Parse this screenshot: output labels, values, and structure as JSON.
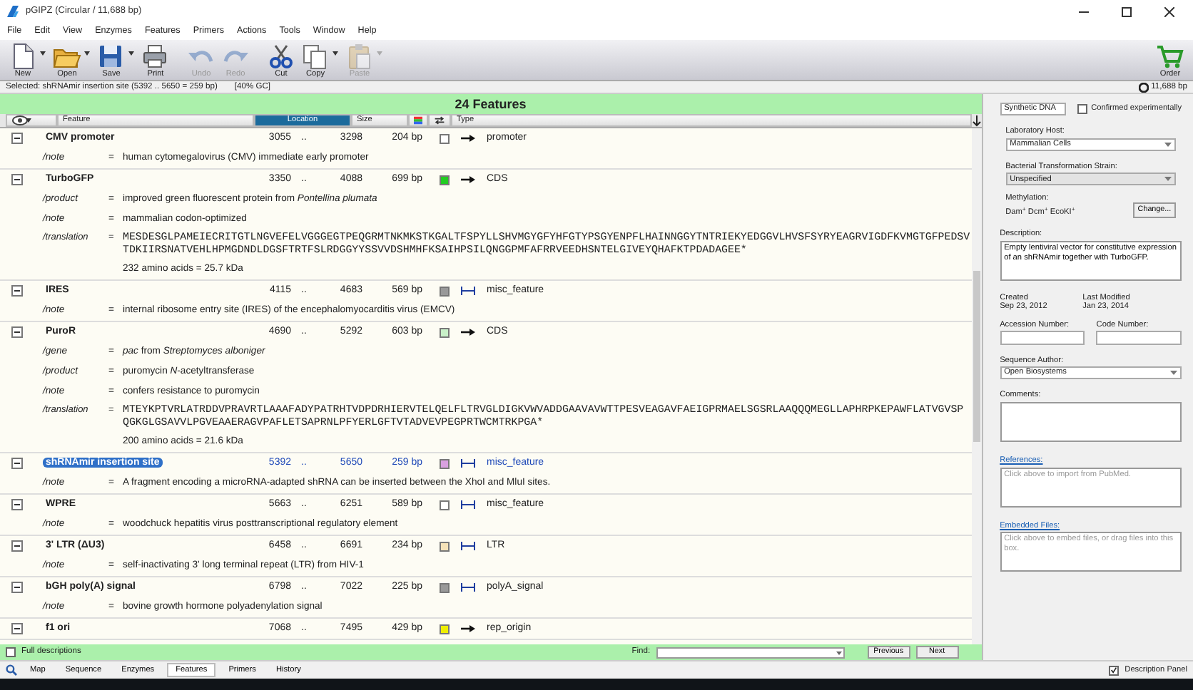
{
  "window": {
    "title": "pGIPZ  (Circular / 11,688 bp)"
  },
  "menu": [
    "File",
    "Edit",
    "View",
    "Enzymes",
    "Features",
    "Primers",
    "Actions",
    "Tools",
    "Window",
    "Help"
  ],
  "toolbar": [
    {
      "label": "New",
      "has_menu": true,
      "disabled": false
    },
    {
      "label": "Open",
      "has_menu": true,
      "disabled": false
    },
    {
      "label": "Save",
      "has_menu": true,
      "disabled": false
    },
    {
      "label": "Print",
      "has_menu": false,
      "disabled": false
    },
    {
      "label": "Undo",
      "has_menu": false,
      "disabled": true
    },
    {
      "label": "Redo",
      "has_menu": false,
      "disabled": true
    },
    {
      "label": "Cut",
      "has_menu": false,
      "disabled": false
    },
    {
      "label": "Copy",
      "has_menu": true,
      "disabled": false
    },
    {
      "label": "Paste",
      "has_menu": true,
      "disabled": true
    }
  ],
  "order_button": {
    "label": "Order"
  },
  "selection_bar": {
    "text": "Selected:  shRNAmir insertion site  (5392 .. 5650  =  259 bp)",
    "gc": "[40% GC]",
    "length": "11,688 bp"
  },
  "features_panel": {
    "title": "24 Features",
    "columns": [
      {
        "label": "Feature",
        "selected": false
      },
      {
        "label": "Location",
        "selected": true
      },
      {
        "label": "Size",
        "selected": false
      },
      {
        "label": "Type",
        "selected": false
      }
    ],
    "features": [
      {
        "name": "CMV promoter",
        "start": "3055",
        "sep": "..",
        "end": "3298",
        "size": "204 bp",
        "color": "#ffffff",
        "kind": "forward",
        "type": "promoter",
        "expanded": true,
        "selected": false,
        "qualifiers": [
          {
            "kind": "text",
            "key": "/note",
            "eq": "=",
            "value": "human cytomegalovirus (CMV) immediate early promoter"
          }
        ]
      },
      {
        "name": "TurboGFP",
        "start": "3350",
        "sep": "..",
        "end": "4088",
        "size": "699 bp",
        "color": "#22cc22",
        "kind": "forward",
        "type": "CDS",
        "expanded": true,
        "selected": false,
        "qualifiers": [
          {
            "kind": "text",
            "key": "/product",
            "eq": "=",
            "value": "improved green fluorescent protein from *Pontellina plumata*"
          },
          {
            "kind": "text",
            "key": "/note",
            "eq": "=",
            "value": "mammalian codon-optimized"
          },
          {
            "kind": "translation",
            "key": "/translation",
            "eq": "=",
            "lines": [
              "MESDESGLPAMEIECRITGTLNGVEFELVGGGEGTPEQGRMTNKMKSTKGALTFSPYLLSHVMGYGFYHFGTYPSGYENPFLHAINNGGYTNTRIEKYEDGGVLHVSFSYRYEAGRVIGDFKVMGTGFPEDSV",
              "TDKIIRSNATVEHLHPMGDNDLDGSFTRTFSLRDGGYYSSVVDSHMHFKSAIHPSILQNGGPMFAFRRVEEDHSNTELGIVEYQHAFKTPDADAGEE*"
            ],
            "summary": "232 amino acids  =  25.7 kDa"
          }
        ]
      },
      {
        "name": "IRES",
        "start": "4115",
        "sep": "..",
        "end": "4683",
        "size": "569 bp",
        "color": "#999999",
        "kind": "none",
        "type": "misc_feature",
        "expanded": true,
        "selected": false,
        "qualifiers": [
          {
            "kind": "text",
            "key": "/note",
            "eq": "=",
            "value": "internal ribosome entry site (IRES) of the encephalomyocarditis virus (EMCV)"
          }
        ]
      },
      {
        "name": "PuroR",
        "start": "4690",
        "sep": "..",
        "end": "5292",
        "size": "603 bp",
        "color": "#c8f0c8",
        "kind": "forward",
        "type": "CDS",
        "expanded": true,
        "selected": false,
        "qualifiers": [
          {
            "kind": "text",
            "key": "/gene",
            "eq": "=",
            "value": "*pac* from *Streptomyces alboniger*"
          },
          {
            "kind": "text",
            "key": "/product",
            "eq": "=",
            "value": "puromycin *N*-acetyltransferase"
          },
          {
            "kind": "text",
            "key": "/note",
            "eq": "=",
            "value": "confers resistance to puromycin"
          },
          {
            "kind": "translation",
            "key": "/translation",
            "eq": "=",
            "lines": [
              "MTEYKPTVRLATRDDVPRAVRTLAAAFADYPATRHTVDPDRHIERVTELQELFLTRVGLDIGKVWVADDGAAVAVWTTPESVEAGAVFAEIGPRMAELSGSRLAAQQQMEGLLAPHRPKEPAWFLATVGVSP",
              "QGKGLGSAVVLPGVEAAERAGVPAFLETSAPRNLPFYERLGFTVTADVEVPEGPRTWCMTRKPGA*"
            ],
            "summary": "200 amino acids  =  21.6 kDa"
          }
        ]
      },
      {
        "name": "shRNAmir insertion site",
        "start": "5392",
        "sep": "..",
        "end": "5650",
        "size": "259 bp",
        "color": "#d8a0e0",
        "kind": "none",
        "type": "misc_feature",
        "expanded": true,
        "selected": true,
        "qualifiers": [
          {
            "kind": "text",
            "key": "/note",
            "eq": "=",
            "value": "A fragment encoding a microRNA-adapted shRNA can be inserted between the XhoI and MluI sites."
          }
        ]
      },
      {
        "name": "WPRE",
        "start": "5663",
        "sep": "..",
        "end": "6251",
        "size": "589 bp",
        "color": "#ffffff",
        "kind": "none",
        "type": "misc_feature",
        "expanded": true,
        "selected": false,
        "qualifiers": [
          {
            "kind": "text",
            "key": "/note",
            "eq": "=",
            "value": "woodchuck hepatitis virus posttranscriptional regulatory element"
          }
        ]
      },
      {
        "name": "3' LTR (ΔU3)",
        "start": "6458",
        "sep": "..",
        "end": "6691",
        "size": "234 bp",
        "color": "#f5e2b8",
        "kind": "none",
        "type": "LTR",
        "expanded": true,
        "selected": false,
        "qualifiers": [
          {
            "kind": "text",
            "key": "/note",
            "eq": "=",
            "value": "self-inactivating 3' long terminal repeat (LTR) from HIV-1"
          }
        ]
      },
      {
        "name": "bGH poly(A) signal",
        "start": "6798",
        "sep": "..",
        "end": "7022",
        "size": "225 bp",
        "color": "#999999",
        "kind": "none",
        "type": "polyA_signal",
        "expanded": true,
        "selected": false,
        "qualifiers": [
          {
            "kind": "text",
            "key": "/note",
            "eq": "=",
            "value": "bovine growth hormone polyadenylation signal"
          }
        ]
      },
      {
        "name": "f1 ori",
        "start": "7068",
        "sep": "..",
        "end": "7495",
        "size": "429 bp",
        "color": "#eeee00",
        "kind": "forward",
        "type": "rep_origin",
        "expanded": true,
        "selected": false
      }
    ],
    "full_descriptions": {
      "label": "Full descriptions",
      "checked": false
    },
    "find": {
      "label": "Find:"
    },
    "buttons": [
      "Previous",
      "Next"
    ]
  },
  "description_panel": {
    "dna_type": "Synthetic DNA",
    "confirmed": {
      "label": "Confirmed experimentally",
      "checked": false
    },
    "lab_host": {
      "label": "Laboratory Host:",
      "value": "Mammalian Cells",
      "disabled": false
    },
    "strain": {
      "label": "Bacterial Transformation Strain:",
      "value": "Unspecified",
      "disabled": true
    },
    "methylation": {
      "label": "Methylation:",
      "value": "Dam$^{+}$  Dcm$^{+}$  EcoKI$^{+}$"
    },
    "change_button": "Change...",
    "description": {
      "label": "Description:",
      "value": "Empty lentiviral vector for constitutive expression of an shRNAmir together with TurboGFP."
    },
    "created": {
      "label": "Created",
      "value": "Sep 23, 2012"
    },
    "modified": {
      "label": "Last Modified",
      "value": "Jan 23, 2014"
    },
    "accession": {
      "label": "Accession Number:"
    },
    "code": {
      "label": "Code Number:"
    },
    "author": {
      "label": "Sequence Author:",
      "value": "Open Biosystems",
      "disabled": false
    },
    "comments": {
      "label": "Comments:"
    },
    "references": {
      "label": "References:",
      "placeholder": "Click above to import from PubMed."
    },
    "embedded": {
      "label": "Embedded Files:",
      "placeholder": "Click above to embed files, or drag files into this box."
    }
  },
  "view_tabs": [
    {
      "label": "Map",
      "selected": false
    },
    {
      "label": "Sequence",
      "selected": false
    },
    {
      "label": "Enzymes",
      "selected": false
    },
    {
      "label": "Features",
      "selected": true
    },
    {
      "label": "Primers",
      "selected": false
    },
    {
      "label": "History",
      "selected": false
    }
  ],
  "description_toggle": {
    "label": "Description Panel",
    "checked": true
  }
}
